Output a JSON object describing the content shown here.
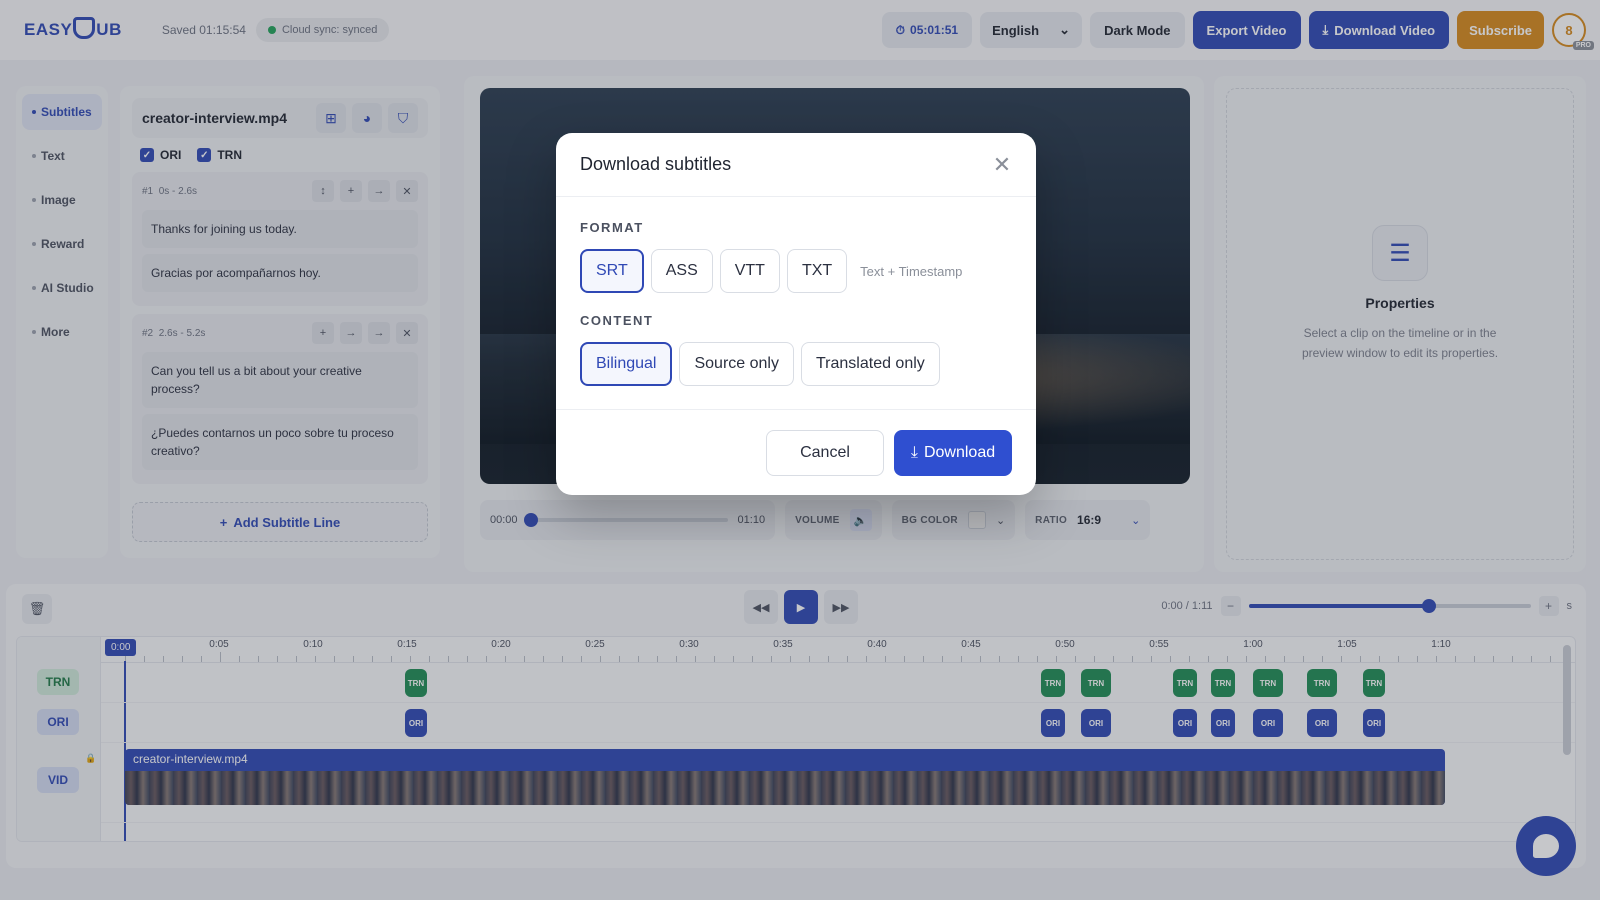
{
  "header": {
    "logo_text": "EASYSUB",
    "logo_prefix": "EASY",
    "logo_suffix": "UB",
    "saved": "Saved 01:15:54",
    "sync": "Cloud sync: synced",
    "timer": "05:01:51",
    "language": "English",
    "dark_mode": "Dark Mode",
    "export": "Export Video",
    "download_video": "Download Video",
    "subscribe": "Subscribe",
    "avatar": "8",
    "badge": "PRO"
  },
  "leftnav": {
    "items": [
      {
        "label": "Subtitles"
      },
      {
        "label": "Text"
      },
      {
        "label": "Image"
      },
      {
        "label": "Reward"
      },
      {
        "label": "AI Studio"
      },
      {
        "label": "More"
      }
    ]
  },
  "subpanel": {
    "filename": "creator-interview.mp4",
    "checks": [
      {
        "label": "ORI"
      },
      {
        "label": "TRN"
      }
    ],
    "items": [
      {
        "index": "#1",
        "range": "0s - 2.6s",
        "original": "Thanks for joining us today.",
        "translated": "Gracias por acompañarnos hoy."
      },
      {
        "index": "#2",
        "range": "2.6s - 5.2s",
        "original": "Can you tell us a bit about your creative process?",
        "translated": "¿Puedes contarnos un poco sobre tu proceso creativo?"
      }
    ],
    "add_line": "Add Subtitle Line"
  },
  "preview": {
    "time_start": "00:00",
    "time_end": "01:10",
    "volume_label": "VOLUME",
    "bg_color_label": "BG COLOR",
    "ratio_label": "RATIO",
    "ratio_value": "16:9"
  },
  "properties": {
    "title": "Properties",
    "description": "Select a clip on the timeline or in the preview window to edit its properties."
  },
  "timeline": {
    "time": "0:00 / 1:11",
    "zoom_unit": "s",
    "zoom_level": 0.64,
    "playhead": "0:00",
    "ticks": [
      "0:00",
      "0:05",
      "0:10",
      "0:15",
      "0:20",
      "0:25",
      "0:30",
      "0:35",
      "0:40",
      "0:45",
      "0:50",
      "0:55",
      "1:00",
      "1:05",
      "1:10"
    ],
    "tracks": {
      "trn": "TRN",
      "ori": "ORI",
      "vid": "VID"
    },
    "clip_label_trn": "TRN",
    "clip_label_ori": "ORI",
    "video_clip_name": "creator-interview.mp4"
  },
  "modal": {
    "title": "Download subtitles",
    "format_label": "FORMAT",
    "formats": [
      "SRT",
      "ASS",
      "VTT",
      "TXT"
    ],
    "format_selected": "SRT",
    "format_hint": "Text + Timestamp",
    "content_label": "CONTENT",
    "contents": [
      "Bilingual",
      "Source only",
      "Translated only"
    ],
    "content_selected": "Bilingual",
    "cancel": "Cancel",
    "download": "Download"
  },
  "colors": {
    "accent": "#2f48b5",
    "translation": "#1f8c55",
    "subscribe": "#d6891c"
  }
}
